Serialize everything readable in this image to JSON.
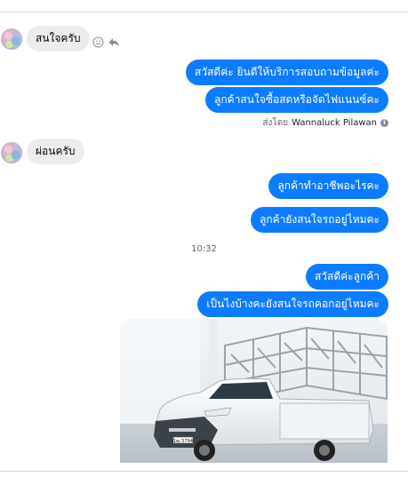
{
  "messages": {
    "incoming_1": "สนใจครับ",
    "outgoing_1": "สวัสดีค่ะ  ยินดีให้บริการสอบถามข้อมูลค่ะ",
    "outgoing_2": "ลูกค้าสนใจซื้อสดหรือจัดไฟแนนซ์คะ",
    "sent_by_prefix": "ส่งโดย",
    "sent_by_name": "Wannaluck Pilawan",
    "incoming_2": "ผ่อนครับ",
    "outgoing_3": "ลูกค้าทำอาชีพอะไรคะ",
    "outgoing_4": "ลูกค้ายังสนใจรถอยู่ไหมคะ",
    "timestamp": "10:32",
    "outgoing_5": "สวัสดีค่ะลูกค้า",
    "outgoing_6": "เป็นไงบ้างคะยังสนใจรถคอกอยู่ไหมคะ"
  },
  "icons": {
    "react": "smiley-icon",
    "reply": "reply-icon",
    "info": "info-icon"
  },
  "photo": {
    "plate_text": "1ฒ 5794"
  },
  "colors": {
    "outgoing_bubble": "#0b7cff",
    "incoming_bubble": "#ececec",
    "divider": "#dcdcdc"
  }
}
